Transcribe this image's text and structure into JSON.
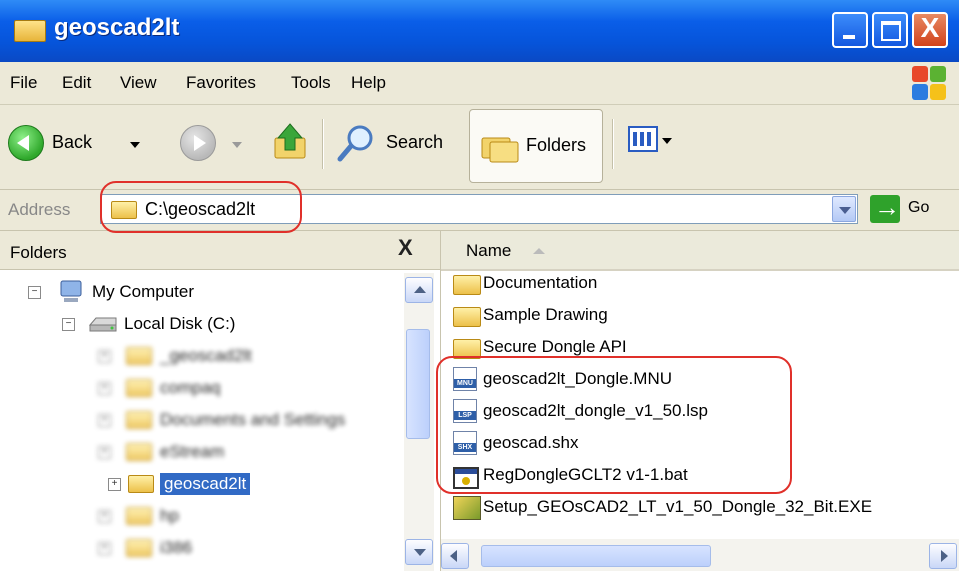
{
  "window": {
    "title": "geoscad2lt",
    "close_glyph": "X",
    "icons": [
      "folder-icon",
      "minimize-icon",
      "maximize-icon",
      "close-icon"
    ]
  },
  "menu": {
    "items": [
      {
        "label": "File"
      },
      {
        "label": "Edit"
      },
      {
        "label": "View"
      },
      {
        "label": "Favorites"
      },
      {
        "label": "Tools"
      },
      {
        "label": "Help"
      }
    ]
  },
  "toolbar": {
    "back_label": "Back",
    "search_label": "Search",
    "folders_label": "Folders",
    "icons": [
      "back-arrow-icon",
      "forward-arrow-icon",
      "up-folder-icon",
      "search-icon",
      "folders-icon",
      "views-icon",
      "windows-logo-icon"
    ]
  },
  "address": {
    "label": "Address",
    "value": "C:\\geoscad2lt",
    "go_label": "Go"
  },
  "folders_pane": {
    "title": "Folders",
    "close_glyph": "X",
    "tree": [
      {
        "label": "My Computer",
        "icon": "computer-icon",
        "expander": "−",
        "blurred": false
      },
      {
        "label": "Local Disk (C:)",
        "icon": "drive-icon",
        "expander": "−",
        "blurred": false
      },
      {
        "label": "_geoscad2lt",
        "icon": "folder-icon",
        "expander": "+",
        "blurred": true
      },
      {
        "label": "compaq",
        "icon": "folder-icon",
        "expander": "+",
        "blurred": true
      },
      {
        "label": "Documents and Settings",
        "icon": "folder-icon",
        "expander": "+",
        "blurred": true
      },
      {
        "label": "eStream",
        "icon": "folder-icon",
        "expander": "+",
        "blurred": true
      },
      {
        "label": "geoscad2lt",
        "icon": "folder-icon",
        "expander": "+",
        "blurred": false,
        "selected": true
      },
      {
        "label": "hp",
        "icon": "folder-icon",
        "expander": "+",
        "blurred": true
      },
      {
        "label": "i386",
        "icon": "folder-icon",
        "expander": "+",
        "blurred": true
      }
    ]
  },
  "file_pane": {
    "column_header": "Name",
    "files": [
      {
        "name": "Documentation",
        "icon": "folder-icon",
        "type": "folder"
      },
      {
        "name": "Sample Drawing",
        "icon": "folder-icon",
        "type": "folder"
      },
      {
        "name": "Secure Dongle API",
        "icon": "folder-icon",
        "type": "folder"
      },
      {
        "name": "geoscad2lt_Dongle.MNU",
        "icon": "mnu-file-icon",
        "type": "doc",
        "badge": "MNU"
      },
      {
        "name": "geoscad2lt_dongle_v1_50.lsp",
        "icon": "lsp-file-icon",
        "type": "doc",
        "badge": "LSP"
      },
      {
        "name": "geoscad.shx",
        "icon": "shx-file-icon",
        "type": "doc",
        "badge": "SHX"
      },
      {
        "name": "RegDongleGCLT2 v1-1.bat",
        "icon": "batch-file-icon",
        "type": "bat"
      },
      {
        "name": "Setup_GEOsCAD2_LT_v1_50_Dongle_32_Bit.EXE",
        "icon": "installer-icon",
        "type": "exe"
      }
    ]
  },
  "colors": {
    "titlebar": "#0a5ee8",
    "chrome": "#ece9d8",
    "selection": "#316ac5",
    "highlight": "#e0302a"
  }
}
